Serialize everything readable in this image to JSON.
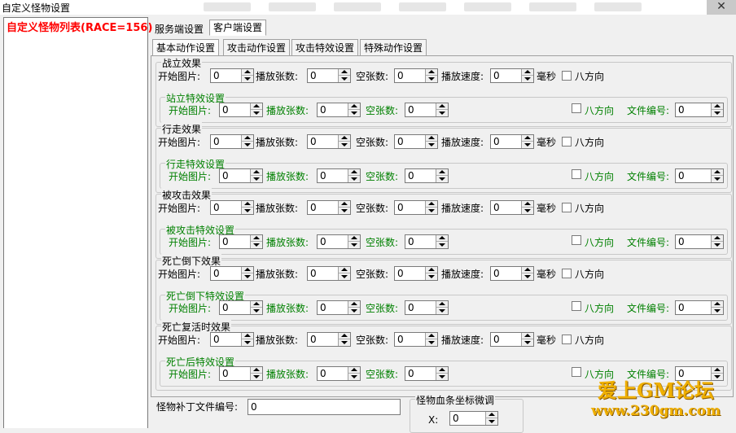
{
  "window": {
    "title": "自定义怪物设置",
    "close_glyph": "✕"
  },
  "list": {
    "header": "自定义怪物列表(RACE=156)"
  },
  "tabs": [
    {
      "label": "服务端设置",
      "active": false
    },
    {
      "label": "客户端设置",
      "active": true
    }
  ],
  "subtabs": [
    {
      "label": "基本动作设置",
      "active": true
    },
    {
      "label": "攻击动作设置",
      "active": false
    },
    {
      "label": "攻击特效设置",
      "active": false
    },
    {
      "label": "特殊动作设置",
      "active": false
    }
  ],
  "labels": {
    "start_image": "开始图片:",
    "play_count": "播放张数:",
    "empty_count": "空张数:",
    "play_speed": "播放速度:",
    "ms": "毫秒",
    "eight_dir": "八方向",
    "file_no": "文件编号:"
  },
  "groups": [
    {
      "title": "战立效果",
      "fx_title": "站立特效设置",
      "start": "0",
      "count": "0",
      "empty": "0",
      "speed": "0",
      "fx_start": "0",
      "fx_count": "0",
      "fx_empty": "0",
      "fx_file": "0"
    },
    {
      "title": "行走效果",
      "fx_title": "行走特效设置",
      "start": "0",
      "count": "0",
      "empty": "0",
      "speed": "0",
      "fx_start": "0",
      "fx_count": "0",
      "fx_empty": "0",
      "fx_file": "0"
    },
    {
      "title": "被攻击效果",
      "fx_title": "被攻击特效设置",
      "start": "0",
      "count": "0",
      "empty": "0",
      "speed": "0",
      "fx_start": "0",
      "fx_count": "0",
      "fx_empty": "0",
      "fx_file": "0"
    },
    {
      "title": "死亡倒下效果",
      "fx_title": "死亡倒下特效设置",
      "start": "0",
      "count": "0",
      "empty": "0",
      "speed": "0",
      "fx_start": "0",
      "fx_count": "0",
      "fx_empty": "0",
      "fx_file": "0"
    },
    {
      "title": "死亡复活时效果",
      "fx_title": "死亡后特效设置",
      "start": "0",
      "count": "0",
      "empty": "0",
      "speed": "0",
      "fx_start": "0",
      "fx_count": "0",
      "fx_empty": "0",
      "fx_file": "0"
    }
  ],
  "patch": {
    "label": "怪物补丁文件编号:",
    "value": "0"
  },
  "hpbar": {
    "title": "怪物血条坐标微调",
    "x_label": "X:",
    "x_value": "0"
  },
  "watermark": {
    "line1": "爱上GM论坛",
    "line2": "www.230gm.com"
  }
}
